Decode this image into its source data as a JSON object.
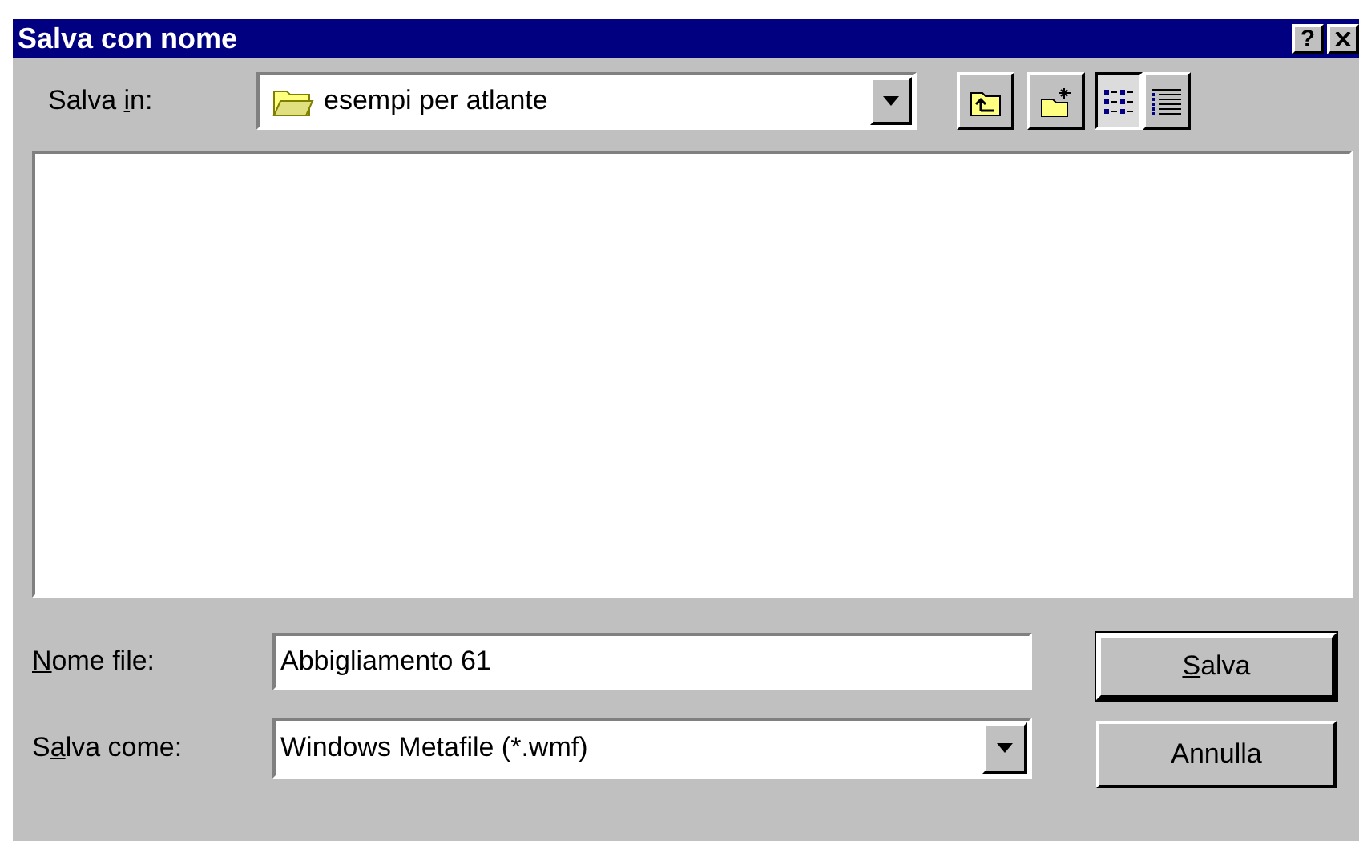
{
  "window": {
    "title": "Salva con nome",
    "help_button": "?"
  },
  "save_in": {
    "label_parts": [
      {
        "text": "Salva ",
        "underlined": false
      },
      {
        "text": "i",
        "underlined": true
      },
      {
        "text": "n:",
        "underlined": false
      }
    ],
    "value": "esempi per atlante"
  },
  "toolbar": [
    {
      "kind": "up-folder"
    },
    {
      "kind": "new-folder"
    }
  ],
  "view_buttons": [
    {
      "kind": "list",
      "selected": true
    },
    {
      "kind": "details",
      "selected": false
    }
  ],
  "file_name": {
    "label_parts": [
      {
        "text": "N",
        "underlined": true
      },
      {
        "text": "ome file:",
        "underlined": false
      }
    ],
    "value": "Abbigliamento 61"
  },
  "save_as_type": {
    "label_parts": [
      {
        "text": "S",
        "underlined": false
      },
      {
        "text": "a",
        "underlined": true
      },
      {
        "text": "lva come:",
        "underlined": false
      }
    ],
    "value": "Windows Metafile (*.wmf)"
  },
  "buttons": [
    {
      "label_parts": [
        {
          "text": "S",
          "underlined": true
        },
        {
          "text": "alva",
          "underlined": false
        }
      ],
      "default": true
    },
    {
      "label_parts": [
        {
          "text": "Annulla",
          "underlined": false
        }
      ],
      "default": false
    }
  ]
}
